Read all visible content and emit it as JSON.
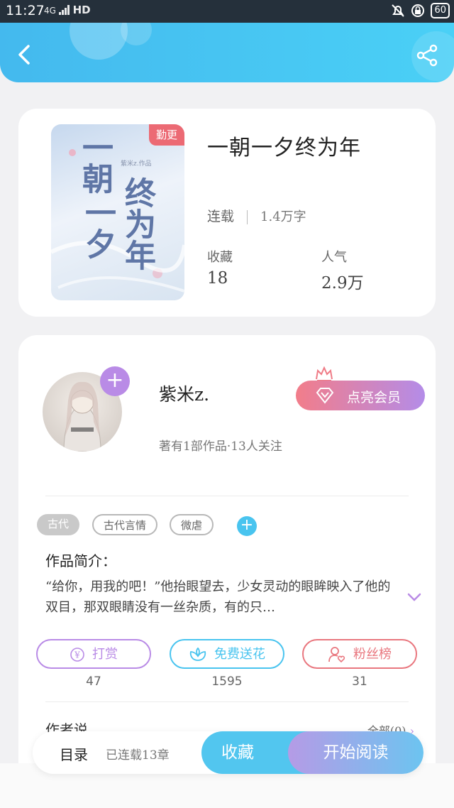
{
  "status_bar": {
    "time": "11:27",
    "network": "4G",
    "hd": "HD",
    "battery": "60"
  },
  "header": {
    "back_icon": "chevron-left-icon",
    "share_icon": "share-icon"
  },
  "book": {
    "cover_tag": "勤更",
    "cover_ink": [
      "一朝",
      "一夕",
      "终为年"
    ],
    "cover_small": "紫米z.作品",
    "title": "一朝一夕终为年",
    "status": "连载",
    "word_count": "1.4万字",
    "collect_label": "收藏",
    "collect_value": "18",
    "popularity_label": "人气",
    "popularity_value": "2.9万"
  },
  "author": {
    "name": "紫米z.",
    "meta": "著有1部作品·13人关注",
    "vip_button": "点亮会员",
    "tags": [
      "古代",
      "古代言情",
      "微虐"
    ],
    "intro_heading": "作品简介：",
    "intro_text": "“给你，用我的吧！”他抬眼望去，少女灵动的眼眸映入了他的双目，那双眼睛没有一丝杂质，有的只…",
    "actions": [
      {
        "label": "打赏",
        "count": "47",
        "color": "#b98be6"
      },
      {
        "label": "免费送花",
        "count": "1595",
        "color": "#49c4ef"
      },
      {
        "label": "粉丝榜",
        "count": "31",
        "color": "#e9777f"
      }
    ],
    "author_say": "作者说",
    "all_link": "全部(0)"
  },
  "bottom_bar": {
    "catalog": "目录",
    "chapters": "已连载13章",
    "collect": "收藏",
    "read": "开始阅读"
  }
}
